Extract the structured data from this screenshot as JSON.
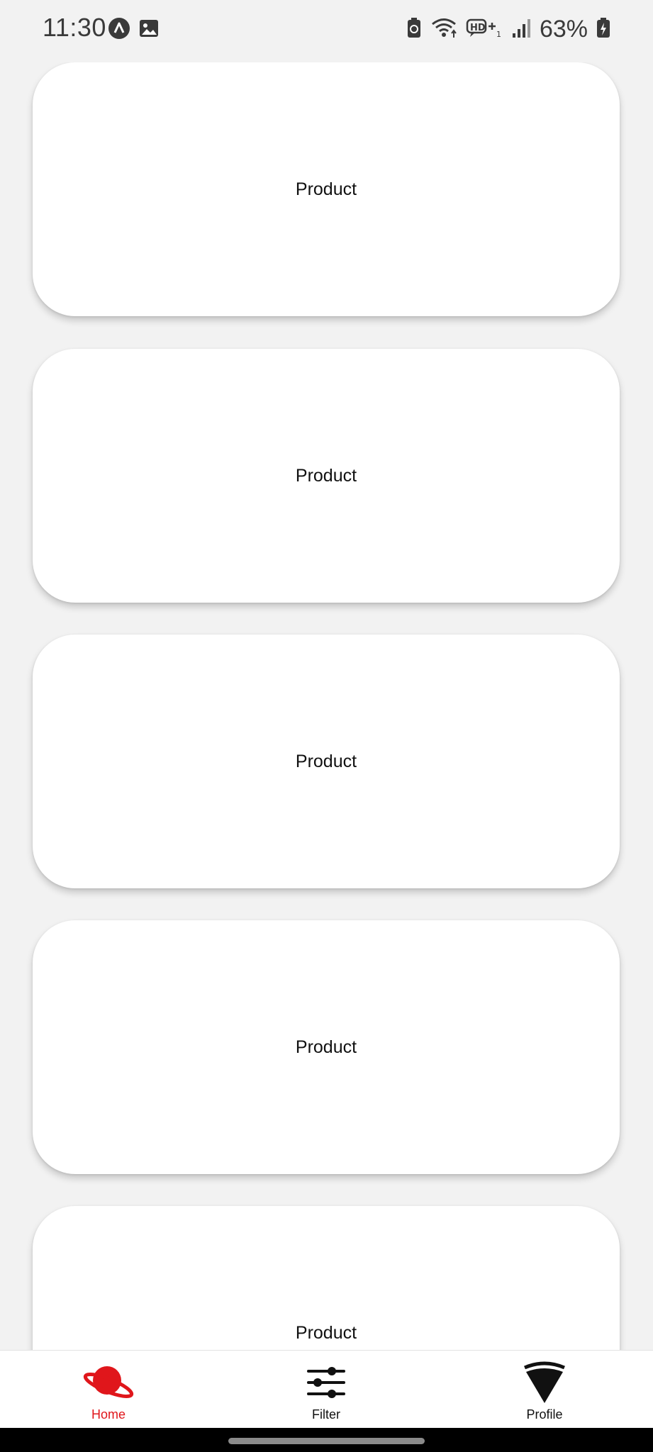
{
  "status_bar": {
    "time": "11:30",
    "left_icons": [
      "app-a-icon",
      "image-icon"
    ],
    "right_icons": [
      "battery-saver-icon",
      "wifi-icon",
      "hd-voice-icon",
      "signal-icon",
      "battery-icon"
    ],
    "battery_percent": "63%"
  },
  "products": [
    {
      "label": "Product"
    },
    {
      "label": "Product"
    },
    {
      "label": "Product"
    },
    {
      "label": "Product"
    },
    {
      "label": "Product"
    }
  ],
  "bottom_nav": {
    "items": [
      {
        "label": "Home",
        "icon": "planet-icon",
        "active": true
      },
      {
        "label": "Filter",
        "icon": "sliders-icon",
        "active": false
      },
      {
        "label": "Profile",
        "icon": "pizza-icon",
        "active": false
      }
    ]
  },
  "colors": {
    "accent": "#e0161b",
    "background": "#f2f2f2",
    "card": "#ffffff"
  }
}
